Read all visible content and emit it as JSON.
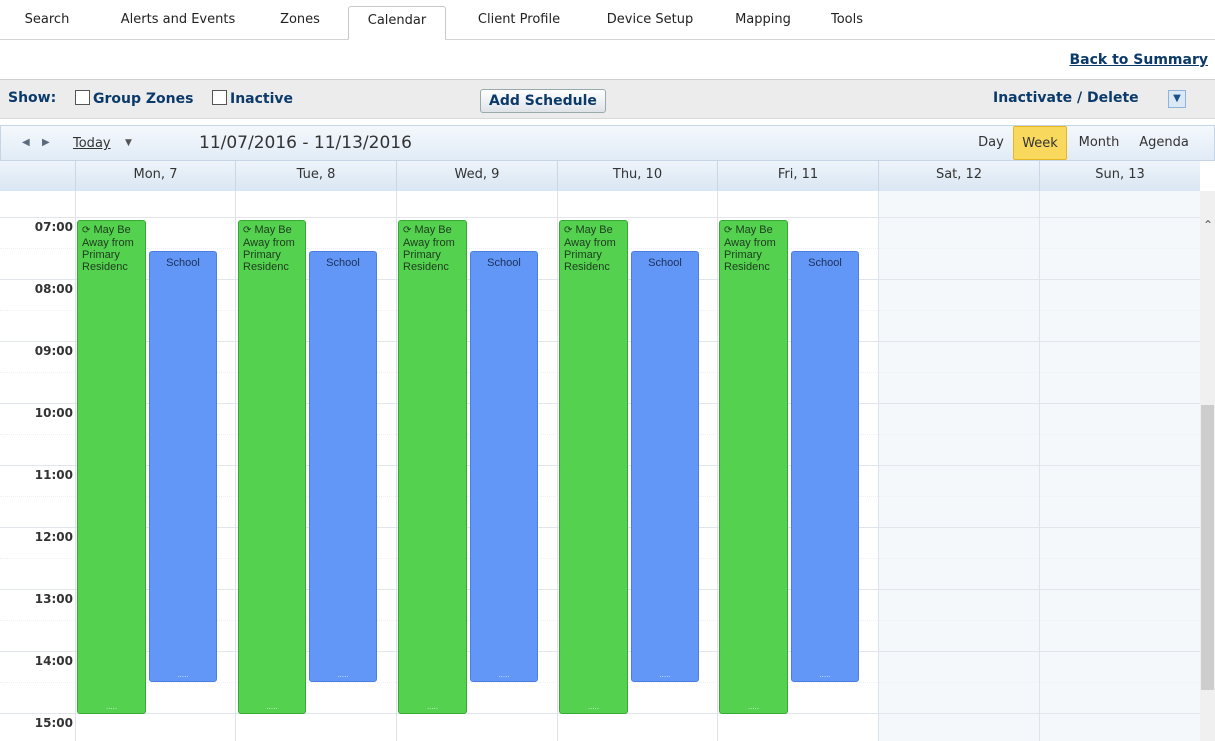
{
  "tabs": [
    {
      "label": "Search"
    },
    {
      "label": "Alerts and Events"
    },
    {
      "label": "Zones"
    },
    {
      "label": "Calendar",
      "active": true
    },
    {
      "label": "Client Profile"
    },
    {
      "label": "Device Setup"
    },
    {
      "label": "Mapping"
    },
    {
      "label": "Tools"
    }
  ],
  "back_link": "Back to Summary",
  "showbar": {
    "show_label": "Show:",
    "group_zones": "Group Zones",
    "group_zones_checked": false,
    "inactive": "Inactive",
    "inactive_checked": false,
    "add_schedule": "Add Schedule",
    "inactivate_delete": "Inactivate / Delete"
  },
  "calbar": {
    "today": "Today",
    "range": "11/07/2016 - 11/13/2016",
    "views": [
      "Day",
      "Week",
      "Month",
      "Agenda"
    ],
    "active_view": "Week"
  },
  "days": [
    "Mon, 7",
    "Tue, 8",
    "Wed, 9",
    "Thu, 10",
    "Fri, 11",
    "Sat, 12",
    "Sun, 13"
  ],
  "hours": [
    "07:00",
    "08:00",
    "09:00",
    "10:00",
    "11:00",
    "12:00",
    "13:00",
    "14:00",
    "15:00"
  ],
  "events": {
    "green_title": "May Be Away from Primary Residenc",
    "blue_title": "School",
    "green_recurring": true,
    "weekdays": 5
  },
  "colors": {
    "green_event": "#53d14f",
    "blue_event": "#6297f8",
    "active_view": "#f9d85e",
    "header": "#d9e6f3",
    "link": "#0b3a6a"
  },
  "icons": {
    "recurring": "recurring-icon",
    "nav_prev": "chevron-left-icon",
    "nav_next": "chevron-right-icon",
    "dropdown": "chevron-down-icon"
  }
}
